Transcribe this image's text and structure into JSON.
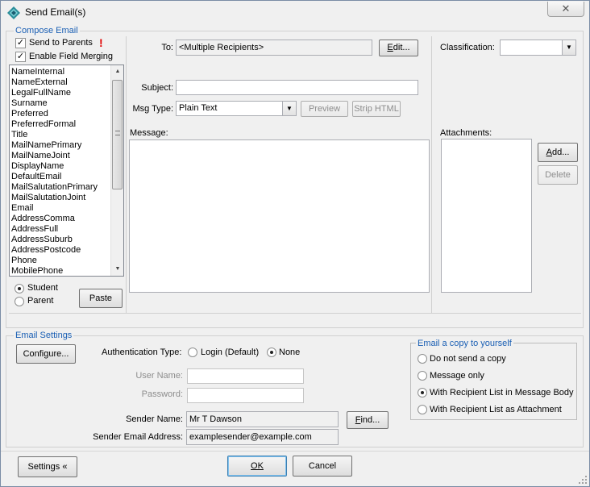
{
  "window": {
    "title": "Send Email(s)",
    "close_symbol": "✕"
  },
  "compose": {
    "legend": "Compose Email",
    "send_to_parents": {
      "label": "Send to Parents",
      "checked": true,
      "warning_symbol": "!"
    },
    "enable_field_merging": {
      "label": "Enable Field Merging",
      "checked": true
    },
    "fields": [
      "NameInternal",
      "NameExternal",
      "LegalFullName",
      "Surname",
      "Preferred",
      "PreferredFormal",
      "Title",
      "MailNamePrimary",
      "MailNameJoint",
      "DisplayName",
      "DefaultEmail",
      "MailSalutationPrimary",
      "MailSalutationJoint",
      "Email",
      "AddressComma",
      "AddressFull",
      "AddressSuburb",
      "AddressPostcode",
      "Phone",
      "MobilePhone"
    ],
    "target_radios": [
      {
        "label": "Student",
        "checked": true
      },
      {
        "label": "Parent",
        "checked": false
      }
    ],
    "paste_button": "Paste",
    "to_label": "To:",
    "to_value": "<Multiple Recipients>",
    "edit_button": "Edit...",
    "subject_label": "Subject:",
    "subject_value": "",
    "msg_type_label": "Msg Type:",
    "msg_type_value": "Plain Text",
    "preview_button": "Preview",
    "strip_html_button": "Strip HTML",
    "message_label": "Message:",
    "message_value": "",
    "classification_label": "Classification:",
    "classification_value": "",
    "attachments_label": "Attachments:",
    "add_button": "Add...",
    "delete_button": "Delete"
  },
  "settings": {
    "legend": "Email Settings",
    "configure_button": "Configure...",
    "auth_label": "Authentication Type:",
    "auth_options": [
      {
        "label": "Login (Default)",
        "checked": false
      },
      {
        "label": "None",
        "checked": true
      }
    ],
    "username_label": "User Name:",
    "username_value": "",
    "password_label": "Password:",
    "password_value": "",
    "sender_name_label": "Sender Name:",
    "sender_name_value": "Mr T Dawson",
    "find_button": "Find...",
    "sender_email_label": "Sender Email Address:",
    "sender_email_value": "examplesender@example.com",
    "copy_group_legend": "Email a copy to yourself",
    "copy_options": [
      {
        "label": "Do not send a copy",
        "checked": false
      },
      {
        "label": "Message only",
        "checked": false
      },
      {
        "label": "With Recipient List in Message Body",
        "checked": true
      },
      {
        "label": "With Recipient List as Attachment",
        "checked": false
      }
    ]
  },
  "footer": {
    "settings_button": "Settings «",
    "ok_button": "OK",
    "cancel_button": "Cancel"
  },
  "colors": {
    "legend": "#1a5fb4",
    "warning": "#e00000",
    "window_bg": "#f0f0f0"
  }
}
